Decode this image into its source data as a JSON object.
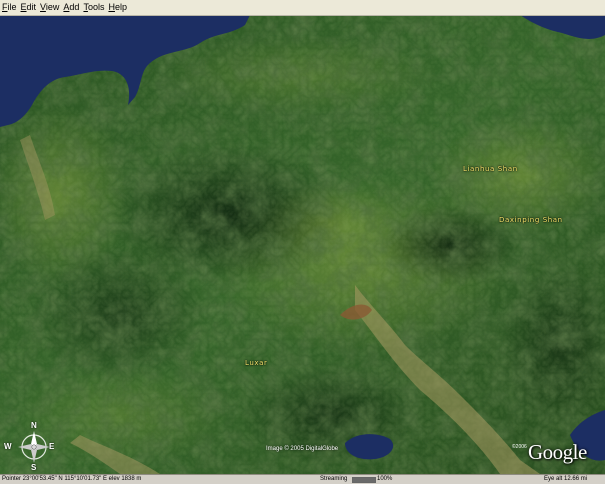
{
  "menubar": {
    "items": [
      {
        "label": "File",
        "underline_index": 0
      },
      {
        "label": "Edit",
        "underline_index": 0
      },
      {
        "label": "View",
        "underline_index": 0
      },
      {
        "label": "Add",
        "underline_index": 0
      },
      {
        "label": "Tools",
        "underline_index": 0
      },
      {
        "label": "Help",
        "underline_index": 0
      }
    ]
  },
  "map": {
    "labels": {
      "lianhua_shan": "Lianhua Shan",
      "daxinping_shan": "Daxinping Shan",
      "luxar": "Luxar"
    },
    "credit": "Image © 2005 DigitalGlobe",
    "logo": "Google",
    "logo_year": "©2006",
    "compass": {
      "n": "N",
      "s": "S",
      "e": "E",
      "w": "W"
    },
    "colors": {
      "water": "#1c2e63",
      "label": "#f2e36a",
      "forest": "#2e5a22"
    }
  },
  "statusbar": {
    "pointer": "Pointer  23°00'53.45\" N  115°10'01.73\" E  elev  1838 m",
    "streaming_label": "Streaming",
    "streaming_percent": "100%",
    "streaming_fraction": 1.0,
    "eye_alt": "Eye  alt  12.66 mi"
  }
}
